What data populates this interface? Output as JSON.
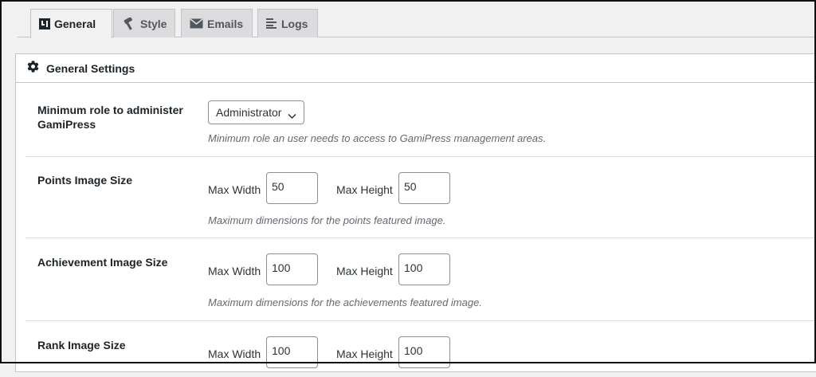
{
  "tabs": [
    {
      "label": "General",
      "icon": "general-icon",
      "active": true
    },
    {
      "label": "Style",
      "icon": "hammer-icon",
      "active": false
    },
    {
      "label": "Emails",
      "icon": "email-icon",
      "active": false
    },
    {
      "label": "Logs",
      "icon": "logs-icon",
      "active": false
    }
  ],
  "panel": {
    "title": "General Settings",
    "icon": "gear-icon"
  },
  "settings": {
    "min_role": {
      "label": "Minimum role to administer GamiPress",
      "value": "Administrator",
      "description": "Minimum role an user needs to access to GamiPress management areas."
    },
    "points_image": {
      "label": "Points Image Size",
      "max_width_label": "Max Width",
      "max_width": "50",
      "max_height_label": "Max Height",
      "max_height": "50",
      "description": "Maximum dimensions for the points featured image."
    },
    "achievement_image": {
      "label": "Achievement Image Size",
      "max_width_label": "Max Width",
      "max_width": "100",
      "max_height_label": "Max Height",
      "max_height": "100",
      "description": "Maximum dimensions for the achievements featured image."
    },
    "rank_image": {
      "label": "Rank Image Size",
      "max_width_label": "Max Width",
      "max_width": "100",
      "max_height_label": "Max Height",
      "max_height": "100"
    }
  }
}
